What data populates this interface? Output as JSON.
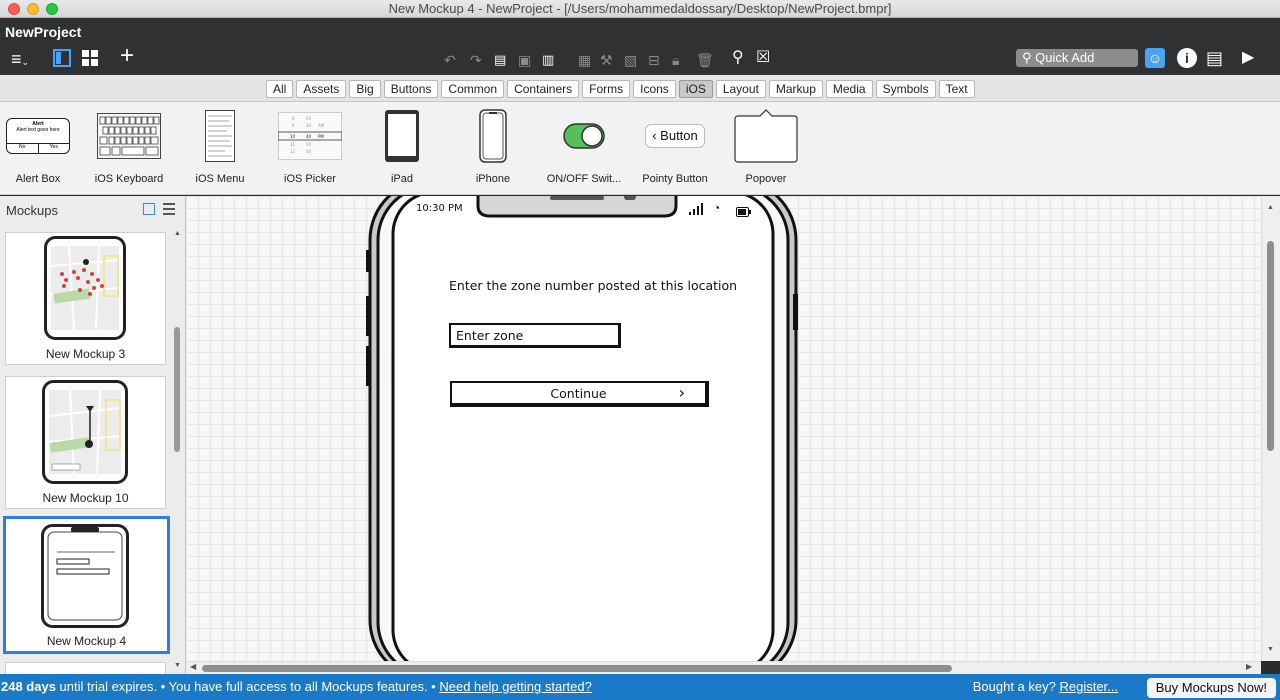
{
  "window": {
    "title": "New Mockup 4 - NewProject - [/Users/mohammedaldossary/Desktop/NewProject.bmpr]"
  },
  "toolbar": {
    "project_name": "NewProject",
    "quick_add_placeholder": "Quick Add"
  },
  "filter_tabs": [
    {
      "label": "All",
      "active": false
    },
    {
      "label": "Assets",
      "active": false
    },
    {
      "label": "Big",
      "active": false
    },
    {
      "label": "Buttons",
      "active": false
    },
    {
      "label": "Common",
      "active": false
    },
    {
      "label": "Containers",
      "active": false
    },
    {
      "label": "Forms",
      "active": false
    },
    {
      "label": "Icons",
      "active": false
    },
    {
      "label": "iOS",
      "active": true
    },
    {
      "label": "Layout",
      "active": false
    },
    {
      "label": "Markup",
      "active": false
    },
    {
      "label": "Media",
      "active": false
    },
    {
      "label": "Symbols",
      "active": false
    },
    {
      "label": "Text",
      "active": false
    }
  ],
  "library": {
    "items": [
      {
        "label": "Alert Box",
        "icon": "alert-box-icon"
      },
      {
        "label": "iOS Keyboard",
        "icon": "ios-keyboard-icon"
      },
      {
        "label": "iOS Menu",
        "icon": "ios-menu-icon"
      },
      {
        "label": "iOS Picker",
        "icon": "ios-picker-icon"
      },
      {
        "label": "iPad",
        "icon": "ipad-icon"
      },
      {
        "label": "iPhone",
        "icon": "iphone-icon"
      },
      {
        "label": "ON/OFF Swit...",
        "icon": "toggle-switch-icon"
      },
      {
        "label": "Pointy Button",
        "icon": "pointy-button-icon"
      },
      {
        "label": "Popover",
        "icon": "popover-icon"
      }
    ],
    "alert_title": "Alert",
    "alert_body": "Alert text goes here",
    "alert_no": "No",
    "alert_yes": "Yes",
    "pointy_label": "Button"
  },
  "sidebar": {
    "title": "Mockups",
    "mockups": [
      {
        "name": "New Mockup 3",
        "selected": false
      },
      {
        "name": "New Mockup 10",
        "selected": false
      },
      {
        "name": "New Mockup 4",
        "selected": true
      }
    ]
  },
  "phone": {
    "time": "10:30 PM",
    "prompt": "Enter the zone number posted at this location",
    "zone_input_placeholder": "Enter zone",
    "continue_label": "Continue",
    "continue_chevron": "›"
  },
  "status": {
    "trial_days": "248 days",
    "trial_text": " until trial expires. • You have full access to all Mockups features. • ",
    "help_link": "Need help getting started?",
    "key_text": "Bought a key? ",
    "register_link": "Register...",
    "buy_button": "Buy Mockups Now!"
  }
}
